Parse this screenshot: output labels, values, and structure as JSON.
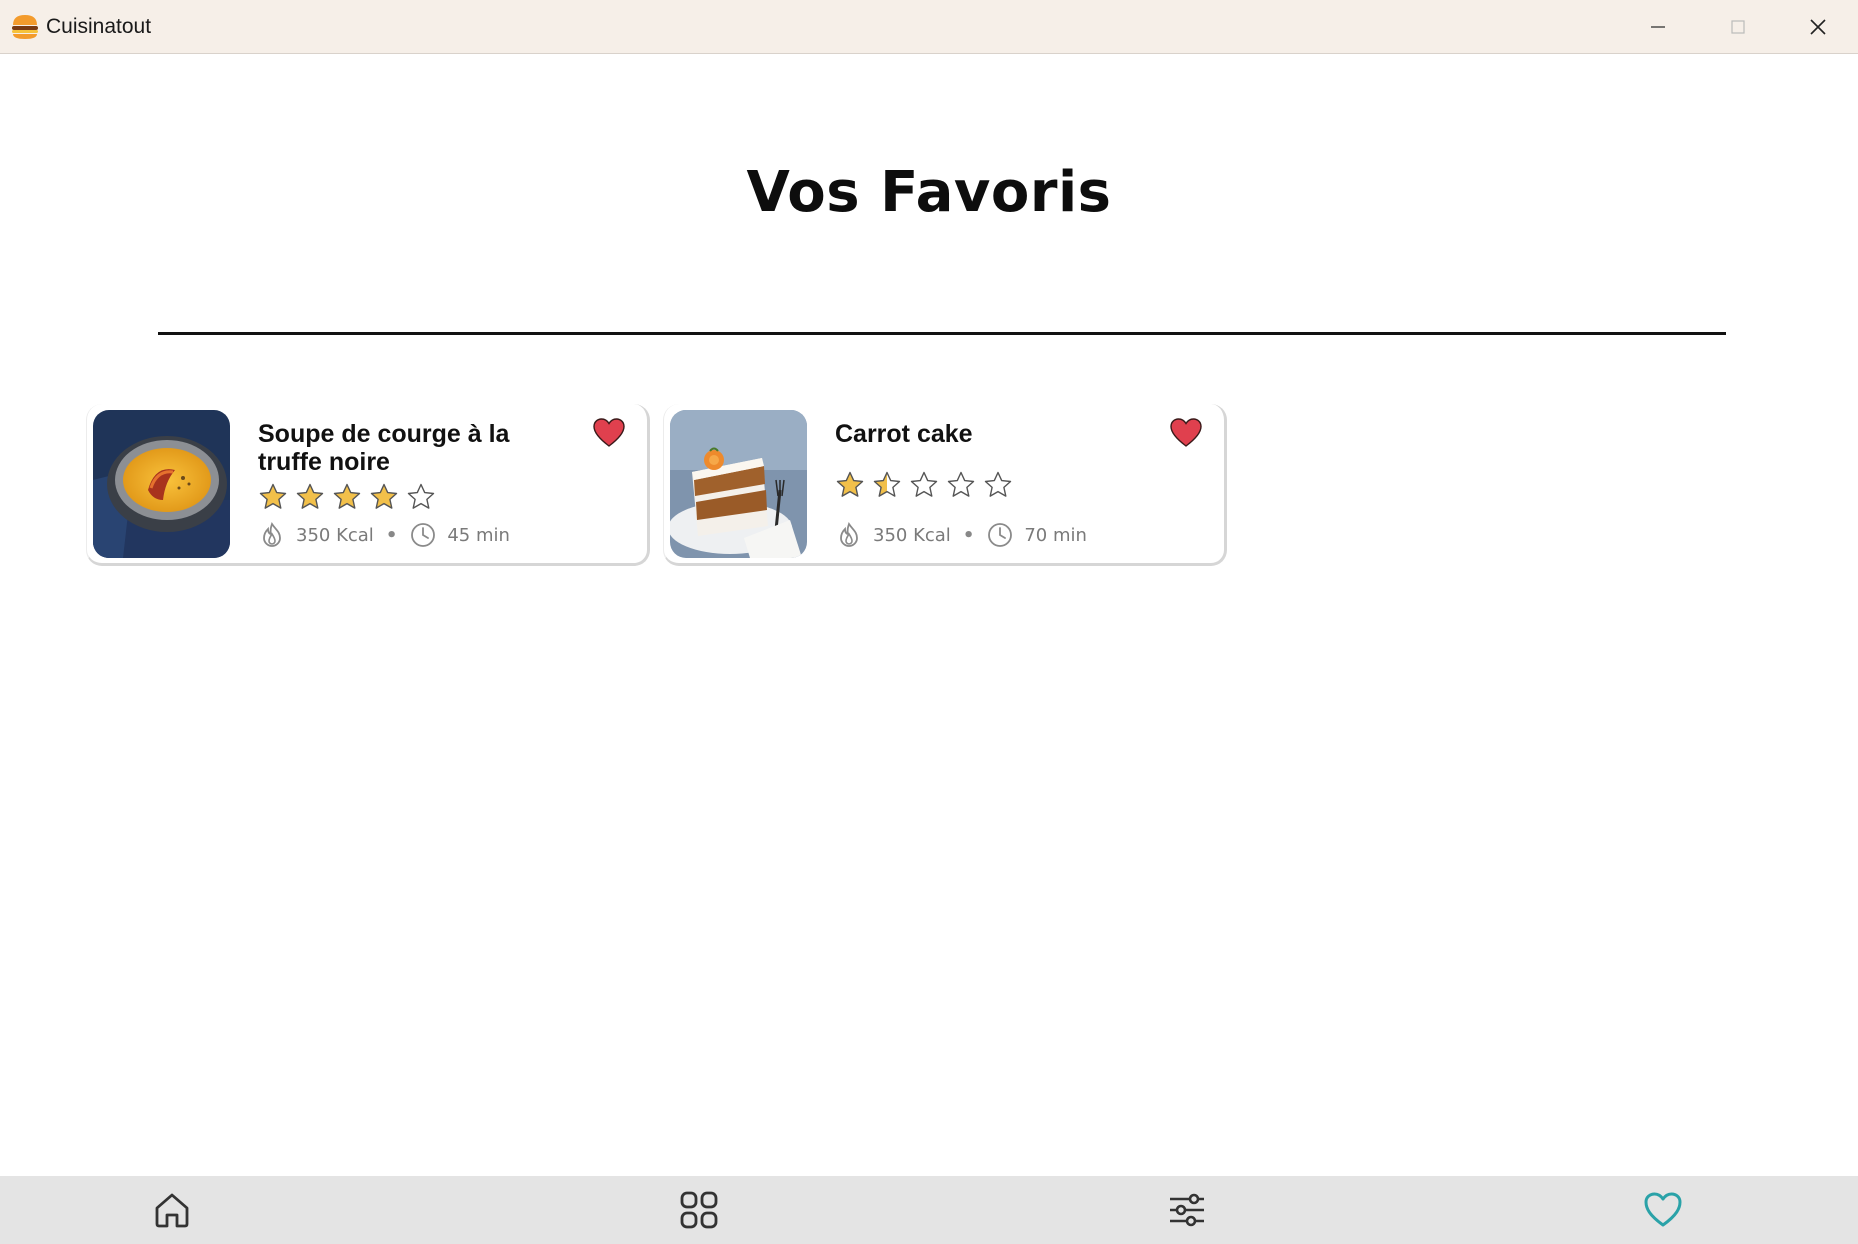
{
  "window": {
    "title": "Cuisinatout",
    "app_icon": "burger-icon",
    "controls": [
      "minimize-icon",
      "maximize-icon",
      "close-icon"
    ]
  },
  "page": {
    "title": "Vos Favoris"
  },
  "favorites": [
    {
      "title": "Soupe de courge à la truffe noire",
      "rating": 4,
      "rating_max": 5,
      "calories": "350 Kcal",
      "separator": "•",
      "duration": "45 min",
      "favorite": true,
      "image": "pumpkin-soup-photo"
    },
    {
      "title": "Carrot cake",
      "rating": 1.5,
      "rating_max": 5,
      "calories": "350 Kcal",
      "separator": "•",
      "duration": "70 min",
      "favorite": true,
      "image": "carrot-cake-photo"
    }
  ],
  "nav": [
    {
      "icon": "home-icon",
      "active": false
    },
    {
      "icon": "grid-icon",
      "active": false
    },
    {
      "icon": "filters-icon",
      "active": false
    },
    {
      "icon": "heart-outline-icon",
      "active": true
    }
  ],
  "colors": {
    "titlebar_bg": "#f6efe8",
    "star_fill": "#f2c04a",
    "heart_red": "#e0404e",
    "nav_active": "#2aa2a8",
    "nav_bg": "#e4e4e4"
  }
}
